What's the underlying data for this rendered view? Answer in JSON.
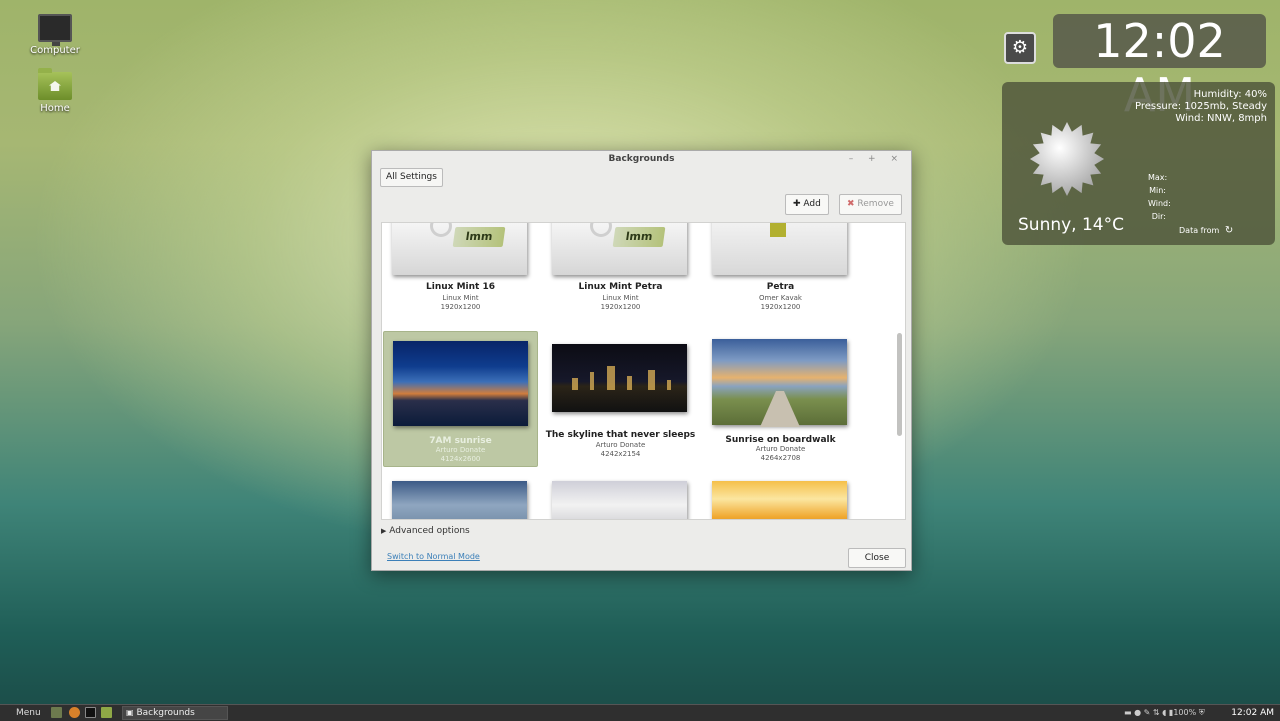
{
  "desktop": {
    "icons": [
      {
        "label": "Computer",
        "icon": "computer-icon"
      },
      {
        "label": "Home",
        "icon": "home-folder-icon"
      }
    ]
  },
  "clock_desklet": {
    "time": "12:02 AM",
    "icon": "clock-settings-icon"
  },
  "weather": {
    "condition": "Sunny, 14°C",
    "humidity": "Humidity: 40%",
    "pressure": "Pressure: 1025mb, Steady",
    "wind": "Wind: NNW, 8mph",
    "rows": [
      "Max:",
      "Min:",
      "Wind:",
      "Dir:"
    ],
    "data_from": "Data from",
    "icon": "sun-icon"
  },
  "dialog": {
    "title": "Backgrounds",
    "window_controls": "– + ×",
    "all_settings": "All Settings",
    "add_label": "Add",
    "remove_label": "Remove",
    "advanced": "Advanced options",
    "switch_mode": "Switch to Normal Mode",
    "close": "Close",
    "selected_index": 3,
    "wallpapers": [
      {
        "name": "Linux Mint 16",
        "author": "Linux Mint",
        "size": "1920x1200"
      },
      {
        "name": "Linux Mint Petra",
        "author": "Linux Mint",
        "size": "1920x1200"
      },
      {
        "name": "Petra",
        "author": "Omer Kavak",
        "size": "1920x1200"
      },
      {
        "name": "7AM sunrise",
        "author": "Arturo Donate",
        "size": "4124x2600"
      },
      {
        "name": "The skyline that never sleeps",
        "author": "Arturo Donate",
        "size": "4242x2154"
      },
      {
        "name": "Sunrise on boardwalk",
        "author": "Arturo Donate",
        "size": "4264x2708"
      }
    ]
  },
  "taskbar": {
    "menu": "Menu",
    "task": "Backgrounds",
    "battery": "100%",
    "time": "12:02 AM"
  }
}
